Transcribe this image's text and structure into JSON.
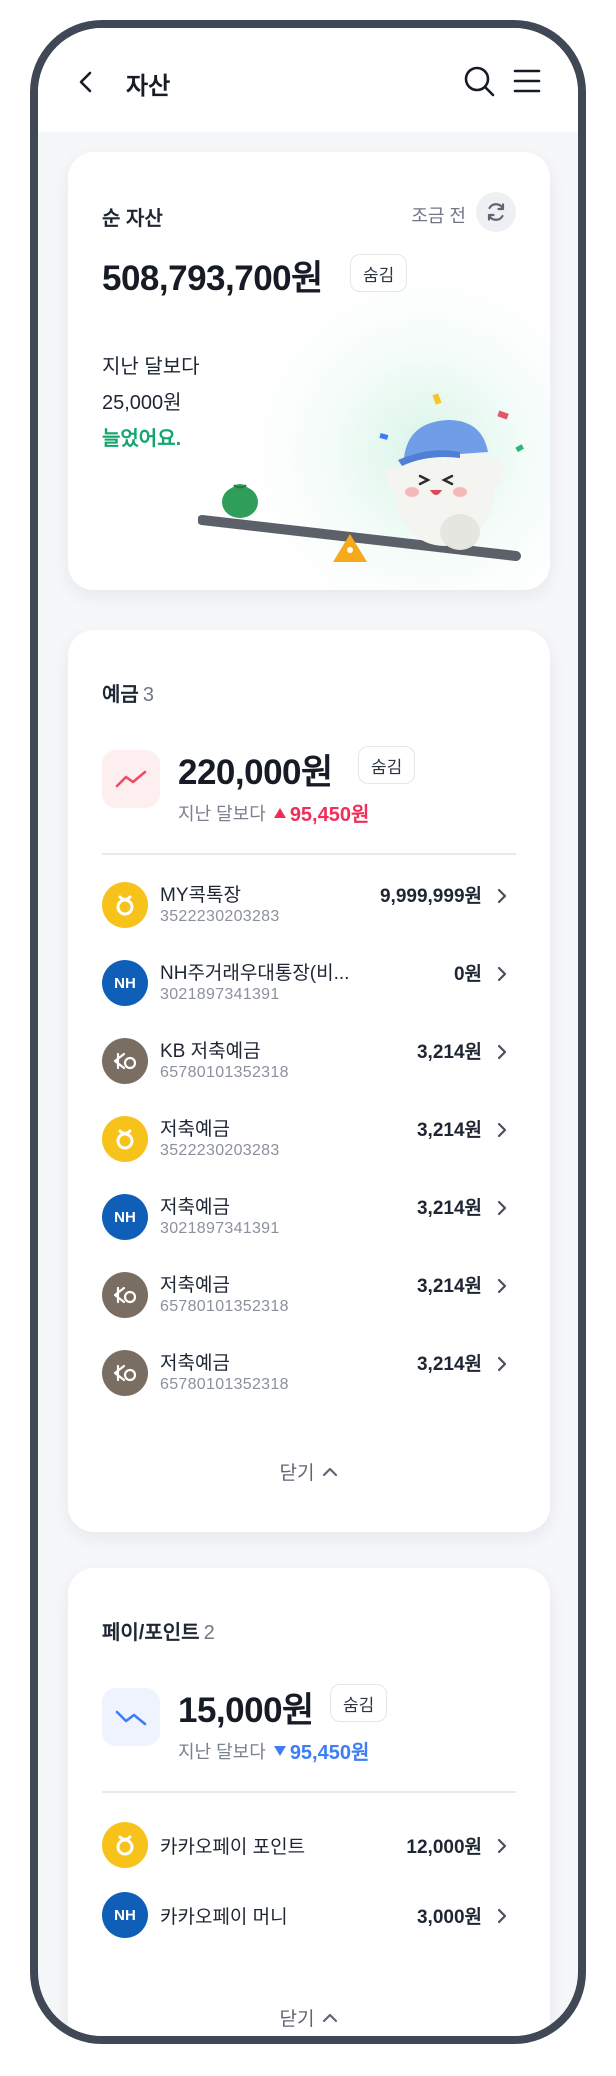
{
  "header": {
    "title": "자산",
    "back_icon": "chevron-left-icon",
    "search_icon": "search-icon",
    "menu_icon": "hamburger-menu-icon"
  },
  "net_asset": {
    "label": "순 자산",
    "updated": "조금 전",
    "amount": "508,793,700원",
    "hide_label": "숨김",
    "compare_line1": "지난 달보다",
    "compare_line2": "25,000원",
    "compare_line3": "늘었어요.",
    "increase_color": "#13a56d"
  },
  "deposits": {
    "title": "예금",
    "count": "3",
    "amount": "220,000원",
    "hide_label": "숨김",
    "compare_label": "지난 달보다",
    "delta": "95,450원",
    "delta_direction": "up",
    "delta_color": "#ef2f5a",
    "close_label": "닫기",
    "accounts": [
      {
        "name": "MY콕톡장",
        "number": "3522230203283",
        "amount": "9,999,999원",
        "logo": "yellow"
      },
      {
        "name": "NH주거래우대통장(비...",
        "number": "3021897341391",
        "amount": "0원",
        "logo": "nh"
      },
      {
        "name": "KB 저축예금",
        "number": "65780101352318",
        "amount": "3,214원",
        "logo": "kb"
      },
      {
        "name": "저축예금",
        "number": "3522230203283",
        "amount": "3,214원",
        "logo": "yellow"
      },
      {
        "name": "저축예금",
        "number": "3021897341391",
        "amount": "3,214원",
        "logo": "nh"
      },
      {
        "name": "저축예금",
        "number": "65780101352318",
        "amount": "3,214원",
        "logo": "kb"
      },
      {
        "name": "저축예금",
        "number": "65780101352318",
        "amount": "3,214원",
        "logo": "kb"
      }
    ]
  },
  "pay": {
    "title": "페이/포인트",
    "count": "2",
    "amount": "15,000원",
    "hide_label": "숨김",
    "compare_label": "지난 달보다",
    "delta": "95,450원",
    "delta_direction": "down",
    "delta_color": "#3d7ef5",
    "close_label": "닫기",
    "accounts": [
      {
        "name": "카카오페이 포인트",
        "amount": "12,000원",
        "logo": "yellow"
      },
      {
        "name": "카카오페이 머니",
        "amount": "3,000원",
        "logo": "nh"
      }
    ]
  },
  "logo_text": {
    "nh": "NH"
  }
}
